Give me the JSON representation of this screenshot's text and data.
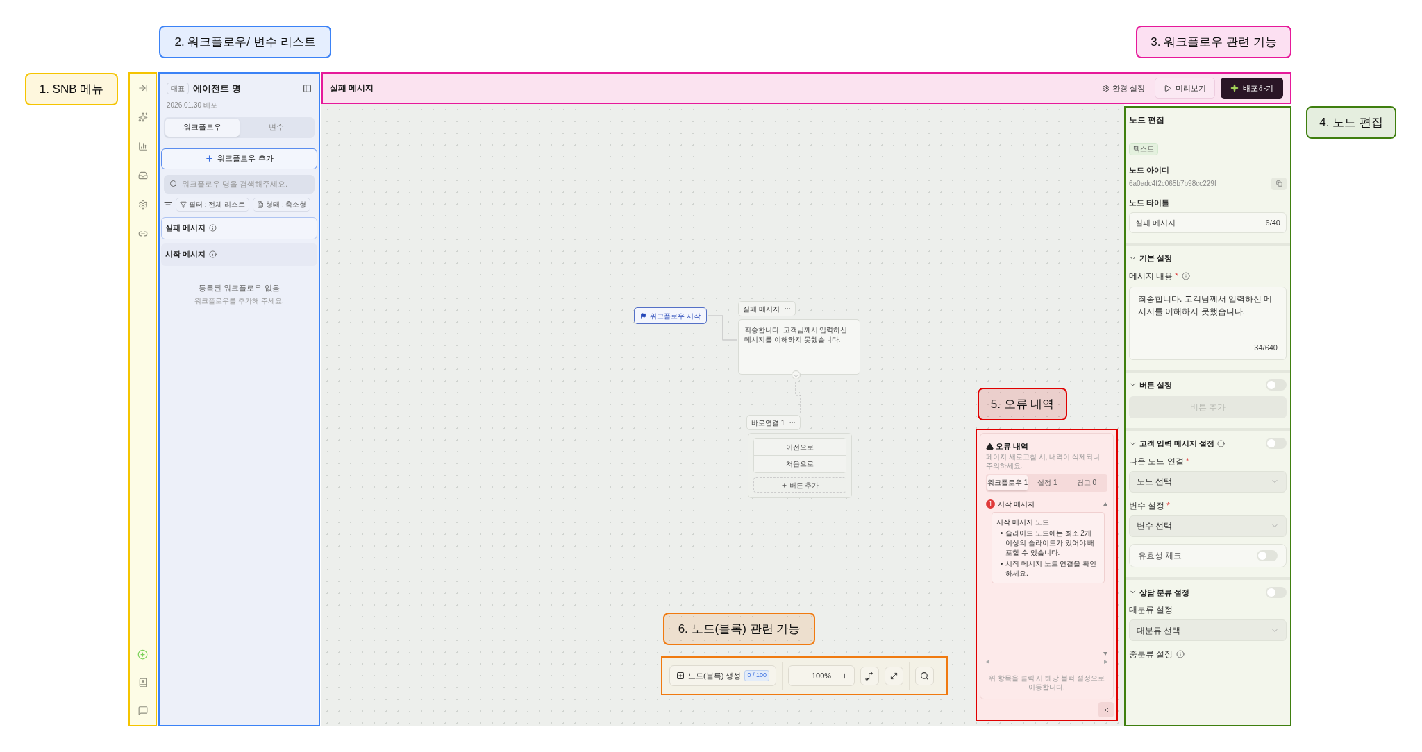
{
  "annotations": [
    {
      "label": "1. SNB 메뉴",
      "color": "#f5c400"
    },
    {
      "label": "2. 워크플로우/ 변수 리스트",
      "color": "#3b82f6"
    },
    {
      "label": "3. 워크플로우 관련 기능",
      "color": "#e6199a"
    },
    {
      "label": "4. 노드 편집",
      "color": "#3f7f0f"
    },
    {
      "label": "5. 오류 내역",
      "color": "#e00000"
    },
    {
      "label": "6. 노드(블록) 관련 기능",
      "color": "#f07a10"
    }
  ],
  "agent_panel": {
    "badge": "대표",
    "name": "에이전트 명",
    "deployed": "2026.01.30 배포",
    "tabs": [
      {
        "label": "워크플로우",
        "selected": true
      },
      {
        "label": "변수",
        "selected": false
      }
    ],
    "add_button": "워크플로우 추가",
    "search": {
      "placeholder": "워크플로우 명을 검색해주세요."
    },
    "filters": [
      "필터 : 전체 리스트",
      "형태 : 축소형"
    ],
    "workflows": [
      {
        "name": "실패 메시지",
        "selected": true
      },
      {
        "name": "시작 메시지",
        "selected": false
      }
    ],
    "empty": {
      "title": "등록된 워크플로우 없음",
      "hint": "워크플로우를 추가해 주세요."
    }
  },
  "header": {
    "title": "실패 메시지",
    "settings": "환경 설정",
    "preview": "미리보기",
    "deploy": "배포하기"
  },
  "canvas": {
    "start_node": "워크플로우 시작",
    "message_node": {
      "title": "실패 메시지",
      "body": "죄송합니다. 고객님께서 입력하신 메시지를 이해하지 못했습니다."
    },
    "button_node": {
      "title": "바로연결 1",
      "buttons": [
        "이전으로",
        "처음으로"
      ],
      "add": "버튼 추가"
    }
  },
  "node_editor": {
    "title": "노드 편집",
    "type": "텍스트",
    "id_label": "노드 아이디",
    "id": "6a0adc4f2c065b7b98cc229f",
    "title_label": "노드 타이틀",
    "title_value": "실패 메시지",
    "title_counter": "6/40",
    "sections": [
      {
        "title": "기본 설정",
        "expanded": true,
        "info": false,
        "fields": [
          {
            "kind": "textarea",
            "label": "메시지 내용",
            "required_mark": "*",
            "info": true,
            "value": "죄송합니다. 고객님께서 입력하신 메시지를 이해하지 못했습니다.",
            "counter": "34/640"
          }
        ]
      },
      {
        "title": "버튼 설정",
        "expanded": true,
        "info": false,
        "toggle": {
          "on": false
        },
        "fields": [
          {
            "kind": "button",
            "label": "버튼 추가",
            "disabled": true
          }
        ]
      },
      {
        "title": "고객 입력 메시지 설정",
        "expanded": true,
        "info": true,
        "toggle": {
          "on": false
        },
        "fields": [
          {
            "kind": "select",
            "label": "다음 노드 연결",
            "required_mark": "*",
            "placeholder": "노드 선택"
          },
          {
            "kind": "select",
            "label": "변수 설정",
            "required_mark": "*",
            "placeholder": "변수 선택"
          },
          {
            "kind": "toggle",
            "label": "유효성 체크",
            "on": false
          }
        ]
      },
      {
        "title": "상담 분류 설정",
        "expanded": true,
        "info": false,
        "toggle": {
          "on": false
        },
        "fields": [
          {
            "kind": "select",
            "label": "대분류 설정",
            "placeholder": "대분류 선택"
          },
          {
            "kind": "label",
            "label": "중분류 설정",
            "info": true
          }
        ]
      }
    ]
  },
  "error_panel": {
    "title": "오류 내역",
    "subtitle": "페이지 새로고침 시, 내역이 삭제되니 주의하세요.",
    "tabs": [
      {
        "label": "워크플로우 1",
        "selected": true
      },
      {
        "label": "설정 1",
        "selected": false
      },
      {
        "label": "경고 0",
        "selected": false
      }
    ],
    "errors": [
      {
        "count": "1",
        "title": "시작 메시지",
        "node": "시작 메시지 노드",
        "messages": [
          "슬라이드 노드에는 최소 2개 이상의 슬라이드가 있어야 배포할 수 있습니다.",
          "시작 메시지 노드 연결을 확인하세요."
        ]
      }
    ],
    "footer": "위 항목을 클릭 시 해당 블럭 설정으로 이동합니다."
  },
  "toolbar": {
    "create": "노드(블록) 생성",
    "count": "0 / 100",
    "zoom": "100%"
  }
}
